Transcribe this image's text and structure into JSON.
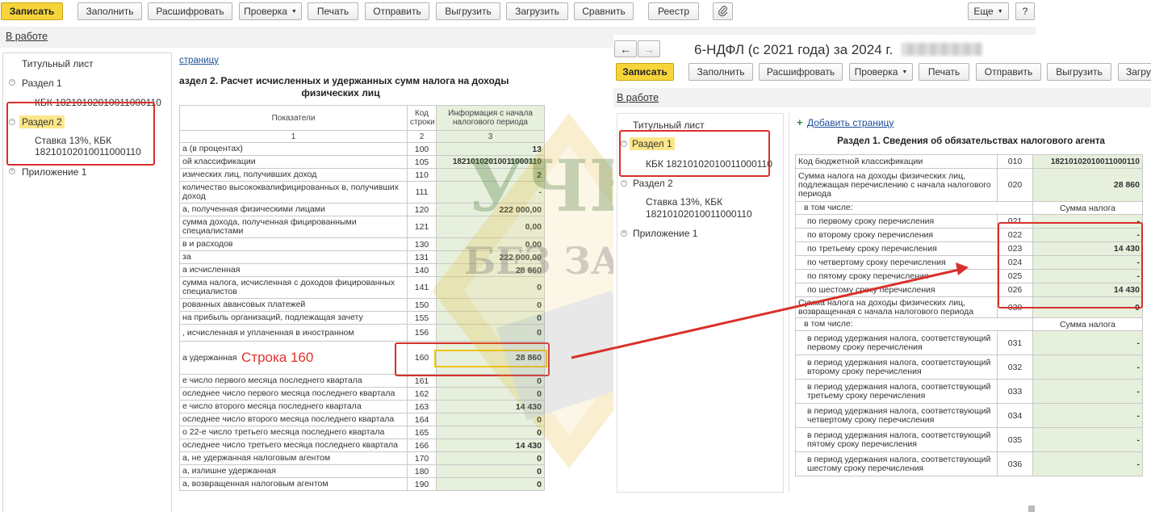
{
  "toolbar_left": {
    "buttons": [
      "Записать",
      "Заполнить",
      "Расшифровать",
      "Проверка",
      "Печать",
      "Отправить",
      "Выгрузить",
      "Загрузить",
      "Сравнить",
      "Реестр"
    ],
    "more": "Еще",
    "help": "?"
  },
  "status_left": "В работе",
  "tree_left": {
    "items": [
      "Титульный лист",
      "Раздел 1",
      "КБК 18210102010011000110",
      "Раздел 2",
      "Ставка 13%, КБК",
      "18210102010011000110",
      "Приложение 1"
    ]
  },
  "left_doc": {
    "add_page": "страницу",
    "title": "аздел 2. Расчет исчисленных и удержанных сумм налога на доходы",
    "title2": "физических лиц",
    "headers": [
      "Показатели",
      "Код строки",
      "Информация с начала налогового периода"
    ],
    "numbers": [
      "1",
      "2",
      "3"
    ],
    "rows": [
      {
        "label": "а (в процентах)",
        "code": "100",
        "value": "13"
      },
      {
        "label": "ой классификации",
        "code": "105",
        "value": "18210102010011000110"
      },
      {
        "label": "изических лиц, получивших доход",
        "code": "110",
        "value": "2"
      },
      {
        "label": "количество высококвалифицированных в, получивших доход",
        "code": "111",
        "value": "-"
      },
      {
        "label": "а, полученная физическими лицами",
        "code": "120",
        "value": "222 000,00"
      },
      {
        "label": "сумма дохода, полученная фицированными специалистами",
        "code": "121",
        "value": "0,00"
      },
      {
        "label": "в и расходов",
        "code": "130",
        "value": "0,00"
      },
      {
        "label": "за",
        "code": "131",
        "value": "222 000,00"
      },
      {
        "label": "а исчисленная",
        "code": "140",
        "value": "28 860"
      },
      {
        "label": "сумма налога, исчисленная с доходов фицированных специалистов",
        "code": "141",
        "value": "0"
      },
      {
        "label": "рованных авансовых платежей",
        "code": "150",
        "value": "0"
      },
      {
        "label": "на прибыль организаций, подлежащая зачету",
        "code": "155",
        "value": "0"
      },
      {
        "label": ", исчисленная и уплаченная в иностранном",
        "code": "156",
        "value": "0"
      },
      {
        "label": "а удержанная",
        "code": "160",
        "value": "28 860"
      },
      {
        "label": "е число первого месяца последнего квартала",
        "code": "161",
        "value": "0"
      },
      {
        "label": "оследнее число первого месяца последнего квартала",
        "code": "162",
        "value": "0"
      },
      {
        "label": "е число второго месяца последнего квартала",
        "code": "163",
        "value": "14 430"
      },
      {
        "label": "оследнее число второго месяца последнего квартала",
        "code": "164",
        "value": "0"
      },
      {
        "label": "о 22-е число третьего месяца последнего квартала",
        "code": "165",
        "value": "0"
      },
      {
        "label": "оследнее число третьего месяца последнего квартала",
        "code": "166",
        "value": "14 430"
      },
      {
        "label": "а, не удержанная налоговым агентом",
        "code": "170",
        "value": "0"
      },
      {
        "label": "а, излишне удержанная",
        "code": "180",
        "value": "0"
      },
      {
        "label": "а, возвращенная налоговым агентом",
        "code": "190",
        "value": "0"
      }
    ],
    "annotation": "Строка 160"
  },
  "watermark": {
    "line1": "УЧЕТ",
    "line2": "БЕЗ ЗАБОТ"
  },
  "right_window": {
    "nav_back": "←",
    "nav_forward": "→",
    "title": "6-НДФЛ (с 2021 года) за 2024 г.",
    "buttons": [
      "Записать",
      "Заполнить",
      "Расшифровать",
      "Проверка",
      "Печать",
      "Отправить",
      "Выгрузить",
      "Загру"
    ],
    "status": "В работе",
    "tree": [
      "Титульный лист",
      "Раздел 1",
      "КБК 18210102010011000110",
      "Раздел 2",
      "Ставка 13%, КБК",
      "18210102010011000110",
      "Приложение 1"
    ],
    "add_page_plus": "+",
    "add_page": "Добавить страницу",
    "doc_title": "Раздел 1. Сведения об обязательствах налогового агента",
    "kbk_row": {
      "label": "Код бюджетной классификации",
      "code": "010",
      "value": "18210102010011000110"
    },
    "row_020": {
      "label": "Сумма налога на доходы физических лиц, подлежащая перечислению с начала налогового периода",
      "code": "020",
      "value": "28 860"
    },
    "incl1": {
      "label": "в том числе:",
      "header": "Сумма налога"
    },
    "terms": [
      {
        "label": "по первому сроку перечисления",
        "code": "021",
        "value": "-"
      },
      {
        "label": "по второму сроку перечисления",
        "code": "022",
        "value": "-"
      },
      {
        "label": "по третьему сроку перечисления",
        "code": "023",
        "value": "14 430"
      },
      {
        "label": "по четвертому сроку перечисления",
        "code": "024",
        "value": "-"
      },
      {
        "label": "по пятому сроку перечисления",
        "code": "025",
        "value": "-"
      },
      {
        "label": "по шестому сроку перечисления",
        "code": "026",
        "value": "14 430"
      }
    ],
    "row_030": {
      "label": "Сумма налога на доходы физических лиц, возвращенная с начала налогового периода",
      "code": "030",
      "value": "0"
    },
    "incl2": {
      "label": "в том числе:",
      "header": "Сумма налога"
    },
    "refunds": [
      {
        "label": "в период удержания налога, соответствующий первому сроку перечисления",
        "code": "031",
        "value": "-"
      },
      {
        "label": "в период удержания налога, соответствующий второму сроку перечисления",
        "code": "032",
        "value": "-"
      },
      {
        "label": "в период удержания налога, соответствующий третьему сроку перечисления",
        "code": "033",
        "value": "-"
      },
      {
        "label": "в период удержания налога, соответствующий четвертому сроку перечисления",
        "code": "034",
        "value": "-"
      },
      {
        "label": "в период удержания налога, соответствующий пятому сроку перечисления",
        "code": "035",
        "value": "-"
      },
      {
        "label": "в период удержания налога, соответствующий шестому сроку перечисления",
        "code": "036",
        "value": "-"
      }
    ]
  },
  "colors": {
    "primary_button": "#f7d43a",
    "value_cell": "#e6f0dc",
    "annotation_red": "#d9302a",
    "selection": "#fbe68a"
  }
}
